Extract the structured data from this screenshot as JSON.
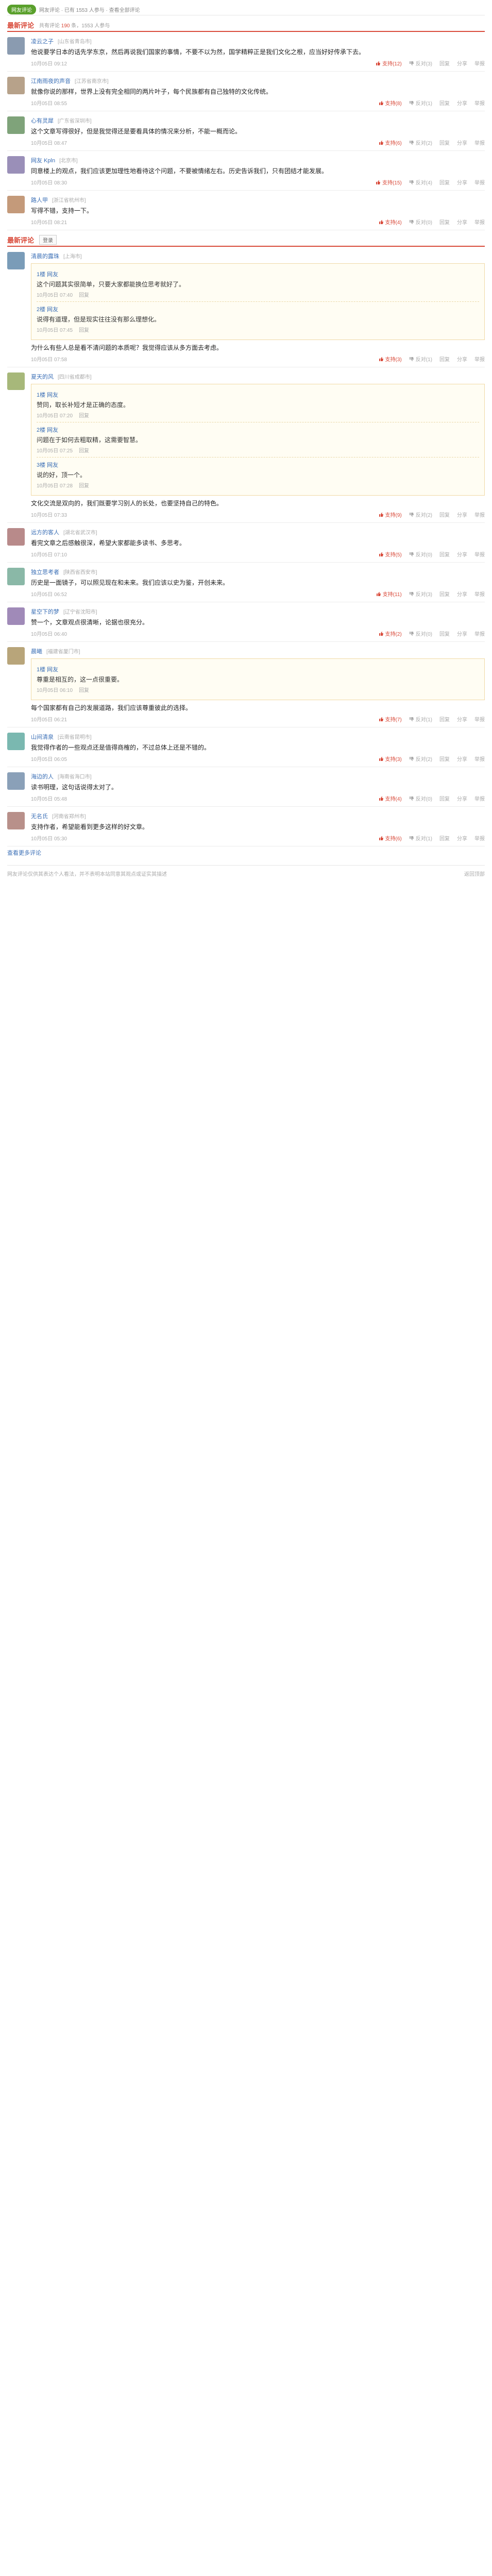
{
  "topbar": {
    "badge": "网友评论",
    "crumb": "网友评论 · 已有 1553 人参与 · 查看全部评论"
  },
  "hot_section": {
    "title": "最新评论",
    "sub_prefix": "共有评论",
    "count": "190",
    "sub_suffix": "条，1553 人参与"
  },
  "all_section": {
    "title": "最新评论",
    "button": "登录"
  },
  "colors": {
    "accent": "#d94b3b",
    "link": "#3b6fb6",
    "brand": "#5aa02c"
  },
  "actions": {
    "reply": "回复",
    "support": "支持",
    "oppose": "反对",
    "report": "举报",
    "share": "分享"
  },
  "hot_comments": [
    {
      "user": "凌云之子",
      "loc": "[山东省青岛市]",
      "text": "他说要学日本的话先学东京，然后再说我们国家的事情，不要不以为然，国学精粹正是我们文化之根，应当好好传承下去。",
      "time": "10月05日 09:12",
      "up": "12",
      "down": "3",
      "avatar": "#8a9bb0"
    },
    {
      "user": "江南雨夜的声音",
      "loc": "[江苏省南京市]",
      "text": "就像你说的那样，世界上没有完全相同的两片叶子，每个民族都有自己独特的文化传统。",
      "time": "10月05日 08:55",
      "up": "8",
      "down": "1",
      "avatar": "#b7a28a"
    },
    {
      "user": "心有灵犀",
      "loc": "[广东省深圳市]",
      "text": "这个文章写得很好，但是我觉得还是要看具体的情况来分析，不能一概而论。",
      "time": "10月05日 08:47",
      "up": "6",
      "down": "2",
      "avatar": "#7fa37a"
    },
    {
      "user": "网友 Kpln",
      "loc": "[北京市]",
      "text": "同意楼上的观点，我们应该更加理性地看待这个问题，不要被情绪左右。历史告诉我们，只有团结才能发展。",
      "time": "10月05日 08:30",
      "up": "15",
      "down": "4",
      "avatar": "#9a8fb8"
    },
    {
      "user": "路人甲",
      "loc": "[浙江省杭州市]",
      "text": "写得不错，支持一下。",
      "time": "10月05日 08:21",
      "up": "4",
      "down": "0",
      "avatar": "#c49a7a"
    }
  ],
  "all_comments": [
    {
      "user": "清晨的露珠",
      "loc": "[上海市]",
      "text": "为什么有些人总是看不清问题的本质呢？我觉得应该从多方面去考虑。",
      "time": "10月05日 07:58",
      "up": "3",
      "down": "1",
      "avatar": "#7a9cb8",
      "quotes": [
        {
          "user": "1楼 网友",
          "text": "这个问题其实很简单，只要大家都能换位思考就好了。",
          "time": "10月05日 07:40"
        },
        {
          "user": "2楼 网友",
          "text": "说得有道理，但是现实往往没有那么理想化。",
          "time": "10月05日 07:45"
        }
      ]
    },
    {
      "user": "夏天的风",
      "loc": "[四川省成都市]",
      "text": "文化交流是双向的，我们既要学习别人的长处，也要坚持自己的特色。",
      "time": "10月05日 07:33",
      "up": "9",
      "down": "2",
      "avatar": "#a7b87a",
      "quotes": [
        {
          "user": "1楼 网友",
          "text": "赞同，取长补短才是正确的态度。",
          "time": "10月05日 07:20"
        },
        {
          "user": "2楼 网友",
          "text": "问题在于如何去粗取精，这需要智慧。",
          "time": "10月05日 07:25"
        },
        {
          "user": "3楼 网友",
          "text": "说的好，顶一个。",
          "time": "10月05日 07:28"
        }
      ]
    },
    {
      "user": "远方的客人",
      "loc": "[湖北省武汉市]",
      "text": "看完文章之后感触很深，希望大家都能多读书、多思考。",
      "time": "10月05日 07:10",
      "up": "5",
      "down": "0",
      "avatar": "#b88a8a",
      "quotes": []
    },
    {
      "user": "独立思考者",
      "loc": "[陕西省西安市]",
      "text": "历史是一面镜子，可以照见现在和未来。我们应该以史为鉴，开创未来。",
      "time": "10月05日 06:52",
      "up": "11",
      "down": "3",
      "avatar": "#8ab8a7",
      "quotes": []
    },
    {
      "user": "星空下的梦",
      "loc": "[辽宁省沈阳市]",
      "text": "赞一个，文章观点很清晰，论据也很充分。",
      "time": "10月05日 06:40",
      "up": "2",
      "down": "0",
      "avatar": "#a08ab8",
      "quotes": []
    },
    {
      "user": "晨曦",
      "loc": "[福建省厦门市]",
      "text": "每个国家都有自己的发展道路，我们应该尊重彼此的选择。",
      "time": "10月05日 06:21",
      "up": "7",
      "down": "1",
      "avatar": "#b8a57a",
      "quotes": [
        {
          "user": "1楼 网友",
          "text": "尊重是相互的，这一点很重要。",
          "time": "10月05日 06:10"
        }
      ]
    },
    {
      "user": "山间清泉",
      "loc": "[云南省昆明市]",
      "text": "我觉得作者的一些观点还是值得商榷的，不过总体上还是不错的。",
      "time": "10月05日 06:05",
      "up": "3",
      "down": "2",
      "avatar": "#7ab8b0",
      "quotes": []
    },
    {
      "user": "海边的人",
      "loc": "[海南省海口市]",
      "text": "读书明理，这句话说得太对了。",
      "time": "10月05日 05:48",
      "up": "4",
      "down": "0",
      "avatar": "#8aa0b8",
      "quotes": []
    },
    {
      "user": "无名氏",
      "loc": "[河南省郑州市]",
      "text": "支持作者，希望能看到更多这样的好文章。",
      "time": "10月05日 05:30",
      "up": "6",
      "down": "1",
      "avatar": "#b8908a",
      "quotes": []
    }
  ],
  "more_link": "查看更多评论",
  "footer": {
    "left": "网友评论仅供其表达个人看法，并不表明本站同意其观点或证实其描述",
    "right": "返回顶部"
  }
}
